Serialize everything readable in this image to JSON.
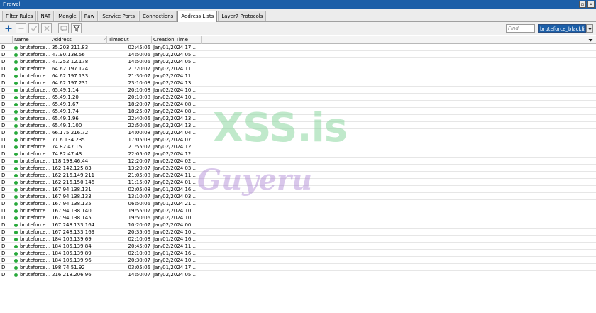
{
  "window": {
    "title": "Firewall"
  },
  "tabs": [
    {
      "label": "Filter Rules",
      "active": false
    },
    {
      "label": "NAT",
      "active": false
    },
    {
      "label": "Mangle",
      "active": false
    },
    {
      "label": "Raw",
      "active": false
    },
    {
      "label": "Service Ports",
      "active": false
    },
    {
      "label": "Connections",
      "active": false
    },
    {
      "label": "Address Lists",
      "active": true
    },
    {
      "label": "Layer7 Protocols",
      "active": false
    }
  ],
  "toolbar": {
    "buttons": [
      "add-icon",
      "remove-icon",
      "enable-icon",
      "disable-icon",
      "comment-icon",
      "filter-icon"
    ],
    "accent_color": "#1c5fa8"
  },
  "search": {
    "placeholder": "Find",
    "value": "",
    "list_value": "bruteforce_blacklist"
  },
  "table": {
    "columns": [
      "",
      "Name",
      "Address",
      "Timeout",
      "Creation Time"
    ],
    "rows": [
      {
        "flag": "D",
        "name": "bruteforce...",
        "address": "35.203.211.83",
        "timeout": "02:45:06",
        "creation_time": "Jan/01/2024 17..."
      },
      {
        "flag": "D",
        "name": "bruteforce...",
        "address": "47.90.138.56",
        "timeout": "14:50:06",
        "creation_time": "Jan/02/2024 05..."
      },
      {
        "flag": "D",
        "name": "bruteforce...",
        "address": "47.252.12.178",
        "timeout": "14:50:06",
        "creation_time": "Jan/02/2024 05..."
      },
      {
        "flag": "D",
        "name": "bruteforce...",
        "address": "64.62.197.124",
        "timeout": "21:20:07",
        "creation_time": "Jan/02/2024 11..."
      },
      {
        "flag": "D",
        "name": "bruteforce...",
        "address": "64.62.197.133",
        "timeout": "21:30:07",
        "creation_time": "Jan/02/2024 11..."
      },
      {
        "flag": "D",
        "name": "bruteforce...",
        "address": "64.62.197.231",
        "timeout": "23:10:08",
        "creation_time": "Jan/02/2024 13..."
      },
      {
        "flag": "D",
        "name": "bruteforce...",
        "address": "65.49.1.14",
        "timeout": "20:10:08",
        "creation_time": "Jan/02/2024 10..."
      },
      {
        "flag": "D",
        "name": "bruteforce...",
        "address": "65.49.1.20",
        "timeout": "20:10:08",
        "creation_time": "Jan/02/2024 10..."
      },
      {
        "flag": "D",
        "name": "bruteforce...",
        "address": "65.49.1.67",
        "timeout": "18:20:07",
        "creation_time": "Jan/02/2024 08..."
      },
      {
        "flag": "D",
        "name": "bruteforce...",
        "address": "65.49.1.74",
        "timeout": "18:25:07",
        "creation_time": "Jan/02/2024 08..."
      },
      {
        "flag": "D",
        "name": "bruteforce...",
        "address": "65.49.1.96",
        "timeout": "22:40:06",
        "creation_time": "Jan/02/2024 13..."
      },
      {
        "flag": "D",
        "name": "bruteforce...",
        "address": "65.49.1.100",
        "timeout": "22:50:06",
        "creation_time": "Jan/02/2024 13..."
      },
      {
        "flag": "D",
        "name": "bruteforce...",
        "address": "66.175.216.72",
        "timeout": "14:00:08",
        "creation_time": "Jan/02/2024 04..."
      },
      {
        "flag": "D",
        "name": "bruteforce...",
        "address": "71.6.134.235",
        "timeout": "17:05:08",
        "creation_time": "Jan/02/2024 07..."
      },
      {
        "flag": "D",
        "name": "bruteforce...",
        "address": "74.82.47.15",
        "timeout": "21:55:07",
        "creation_time": "Jan/02/2024 12..."
      },
      {
        "flag": "D",
        "name": "bruteforce...",
        "address": "74.82.47.43",
        "timeout": "22:05:07",
        "creation_time": "Jan/02/2024 12..."
      },
      {
        "flag": "D",
        "name": "bruteforce...",
        "address": "118.193.46.44",
        "timeout": "12:20:07",
        "creation_time": "Jan/02/2024 02..."
      },
      {
        "flag": "D",
        "name": "bruteforce...",
        "address": "162.142.125.83",
        "timeout": "13:20:07",
        "creation_time": "Jan/02/2024 03..."
      },
      {
        "flag": "D",
        "name": "bruteforce...",
        "address": "162.216.149.211",
        "timeout": "21:05:08",
        "creation_time": "Jan/02/2024 11..."
      },
      {
        "flag": "D",
        "name": "bruteforce...",
        "address": "162.216.150.146",
        "timeout": "11:15:07",
        "creation_time": "Jan/02/2024 01..."
      },
      {
        "flag": "D",
        "name": "bruteforce...",
        "address": "167.94.138.131",
        "timeout": "02:05:08",
        "creation_time": "Jan/01/2024 16..."
      },
      {
        "flag": "D",
        "name": "bruteforce...",
        "address": "167.94.138.133",
        "timeout": "13:10:07",
        "creation_time": "Jan/02/2024 03..."
      },
      {
        "flag": "D",
        "name": "bruteforce...",
        "address": "167.94.138.135",
        "timeout": "06:50:06",
        "creation_time": "Jan/01/2024 21..."
      },
      {
        "flag": "D",
        "name": "bruteforce...",
        "address": "167.94.138.140",
        "timeout": "19:55:07",
        "creation_time": "Jan/02/2024 10..."
      },
      {
        "flag": "D",
        "name": "bruteforce...",
        "address": "167.94.138.145",
        "timeout": "19:50:06",
        "creation_time": "Jan/02/2024 10..."
      },
      {
        "flag": "D",
        "name": "bruteforce...",
        "address": "167.248.133.164",
        "timeout": "10:20:07",
        "creation_time": "Jan/02/2024 00..."
      },
      {
        "flag": "D",
        "name": "bruteforce...",
        "address": "167.248.133.169",
        "timeout": "20:35:06",
        "creation_time": "Jan/02/2024 10..."
      },
      {
        "flag": "D",
        "name": "bruteforce...",
        "address": "184.105.139.69",
        "timeout": "02:10:08",
        "creation_time": "Jan/01/2024 16..."
      },
      {
        "flag": "D",
        "name": "bruteforce...",
        "address": "184.105.139.84",
        "timeout": "20:45:07",
        "creation_time": "Jan/02/2024 11..."
      },
      {
        "flag": "D",
        "name": "bruteforce...",
        "address": "184.105.139.89",
        "timeout": "02:10:08",
        "creation_time": "Jan/01/2024 16..."
      },
      {
        "flag": "D",
        "name": "bruteforce...",
        "address": "184.105.139.96",
        "timeout": "20:30:07",
        "creation_time": "Jan/02/2024 10..."
      },
      {
        "flag": "D",
        "name": "bruteforce...",
        "address": "198.74.51.92",
        "timeout": "03:05:06",
        "creation_time": "Jan/01/2024 17..."
      },
      {
        "flag": "D",
        "name": "bruteforce...",
        "address": "216.218.206.96",
        "timeout": "14:50:07",
        "creation_time": "Jan/02/2024 05..."
      }
    ]
  },
  "watermark": {
    "line1": "XSS.is",
    "line2": "Guyeru"
  },
  "status_dot_color": "#27a83a"
}
